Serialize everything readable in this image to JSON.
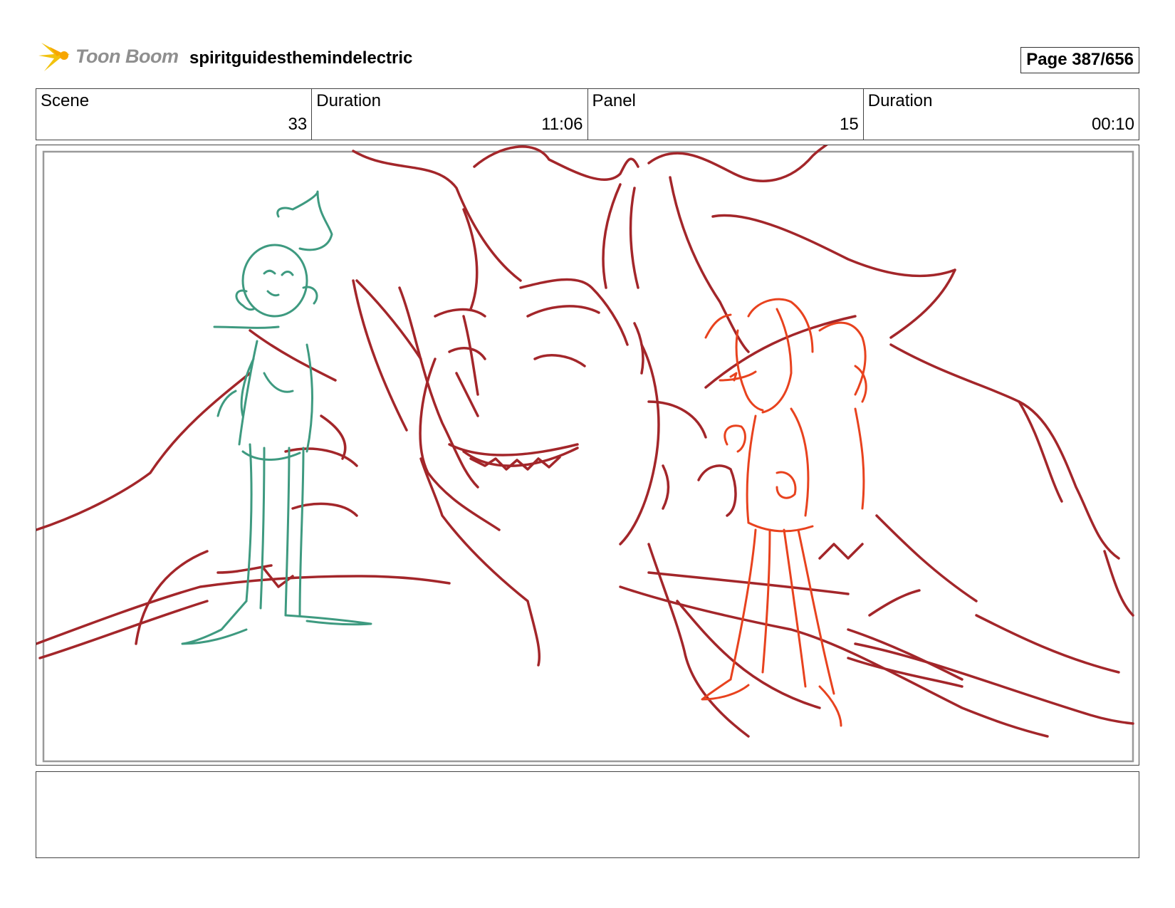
{
  "header": {
    "logo_text": "Toon Boom",
    "project_title": "spiritguidesthemindelectric",
    "page_label": "Page 387/656"
  },
  "info": {
    "scene_label": "Scene",
    "scene_value": "33",
    "scene_duration_label": "Duration",
    "scene_duration_value": "11:06",
    "panel_label": "Panel",
    "panel_value": "15",
    "panel_duration_label": "Duration",
    "panel_duration_value": "00:10"
  },
  "notes": {
    "text": ""
  },
  "colors": {
    "demon_sketch": "#a3262a",
    "green_character": "#3e9a80",
    "orange_character": "#e8421e",
    "logo_yellow": "#f2c20d",
    "logo_text": "#8f8f8f"
  }
}
